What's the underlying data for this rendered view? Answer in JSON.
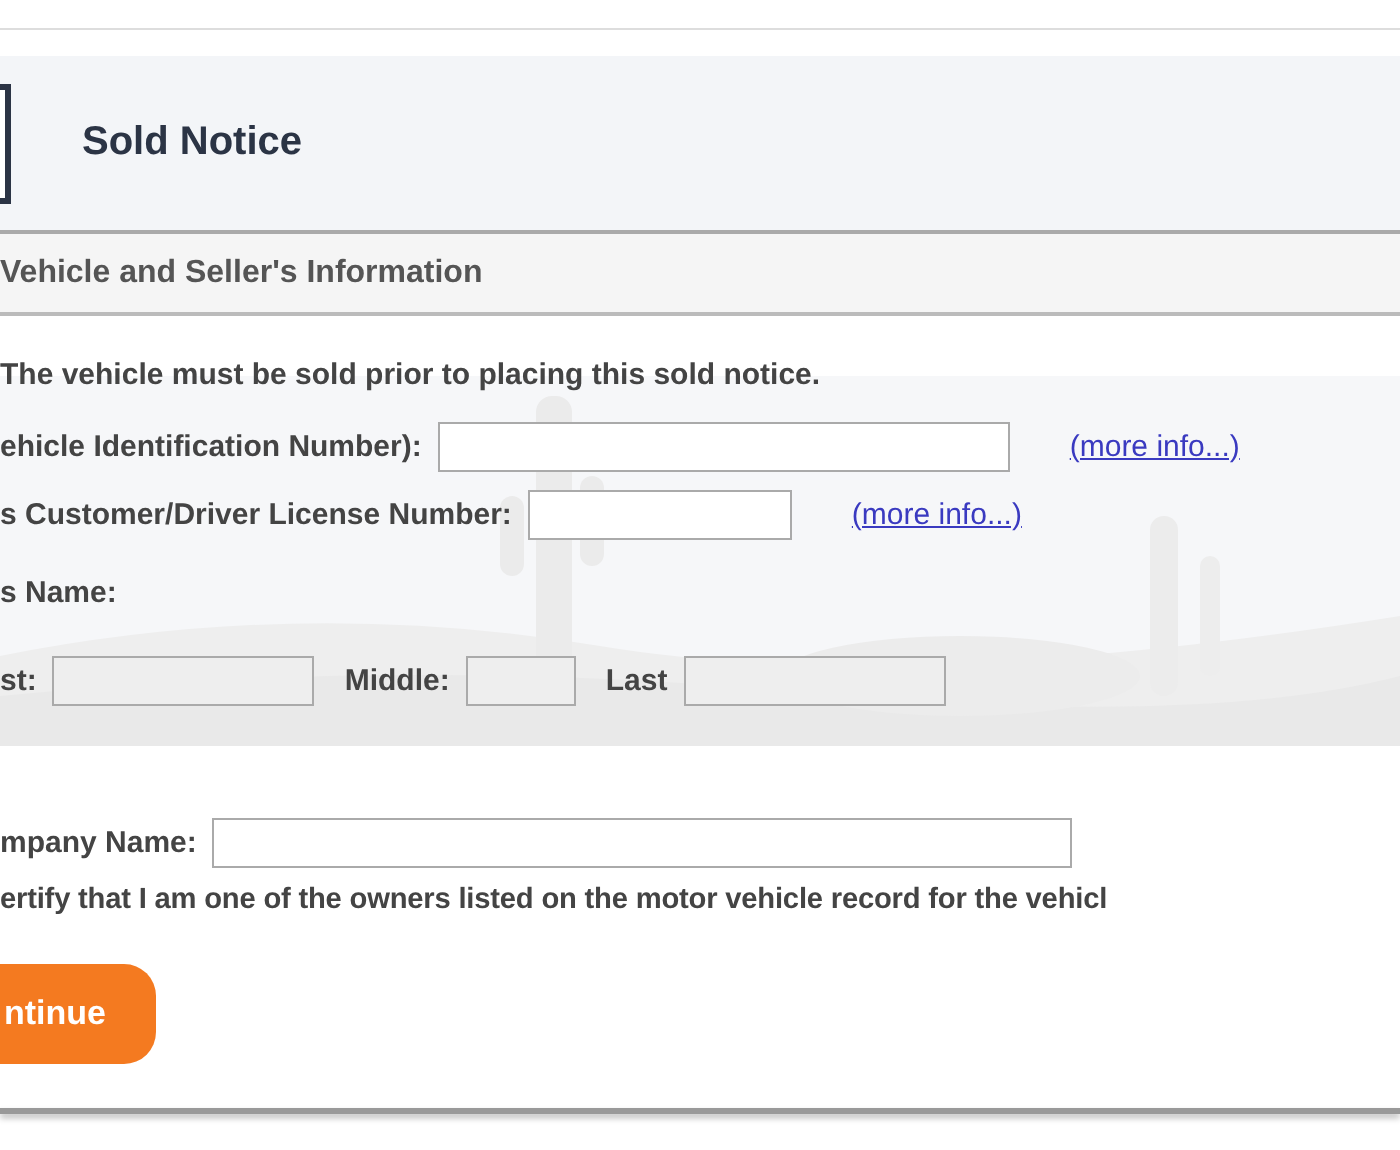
{
  "header": {
    "title": "Sold Notice"
  },
  "section": {
    "heading": "Vehicle and Seller's Information"
  },
  "notice": "The vehicle must be sold prior to placing this sold notice.",
  "id_fields": [
    {
      "label": "ehicle Identification Number):",
      "link": "(more info...)"
    },
    {
      "label": "s Customer/Driver License Number:",
      "link": "(more info...)"
    }
  ],
  "name_label": "s Name:",
  "name_fields": [
    {
      "label": "st:"
    },
    {
      "label": "Middle:"
    },
    {
      "label": "Last"
    }
  ],
  "company": {
    "label": "mpany Name:"
  },
  "certify": "ertify that I am one of the owners listed on the motor vehicle record for the vehicl",
  "button": "ntinue"
}
